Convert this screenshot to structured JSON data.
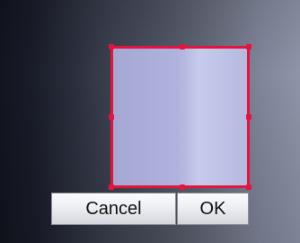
{
  "dialog": {
    "cancel_label": "Cancel",
    "ok_label": "OK"
  },
  "colors": {
    "crop_border": "#e4143e",
    "button_text": "#111111"
  }
}
